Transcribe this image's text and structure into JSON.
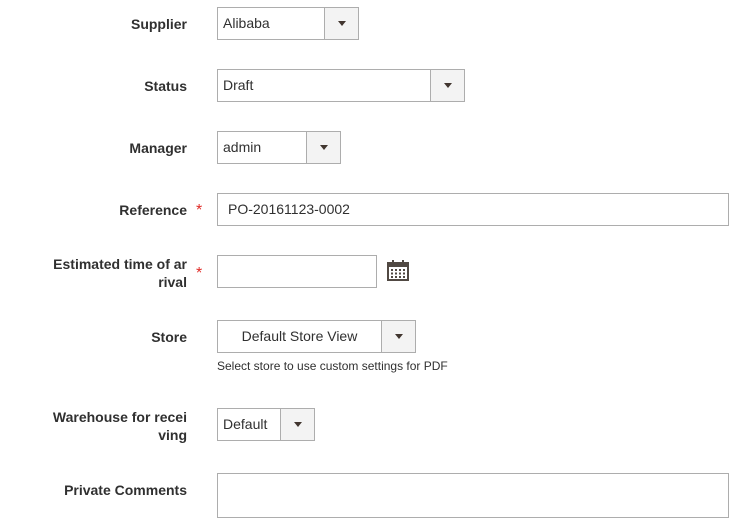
{
  "supplier": {
    "label": "Supplier",
    "value": "Alibaba"
  },
  "status": {
    "label": "Status",
    "value": "Draft"
  },
  "manager": {
    "label": "Manager",
    "value": "admin"
  },
  "reference": {
    "label": "Reference",
    "value": "PO-20161123-0002",
    "required_mark": "*"
  },
  "eta": {
    "label_line1": "Estimated time of ar",
    "label_line2": "rival",
    "value": "",
    "required_mark": "*",
    "icon": "calendar-icon"
  },
  "store": {
    "label": "Store",
    "value": "Default Store View",
    "note": "Select store to use custom settings for PDF"
  },
  "warehouse": {
    "label_line1": "Warehouse for recei",
    "label_line2": "ving",
    "value": "Default"
  },
  "private_comments": {
    "label": "Private Comments",
    "value": ""
  },
  "colors": {
    "required": "#e02b27",
    "border": "#adadad",
    "arrow_bg": "#f3f3f3"
  }
}
